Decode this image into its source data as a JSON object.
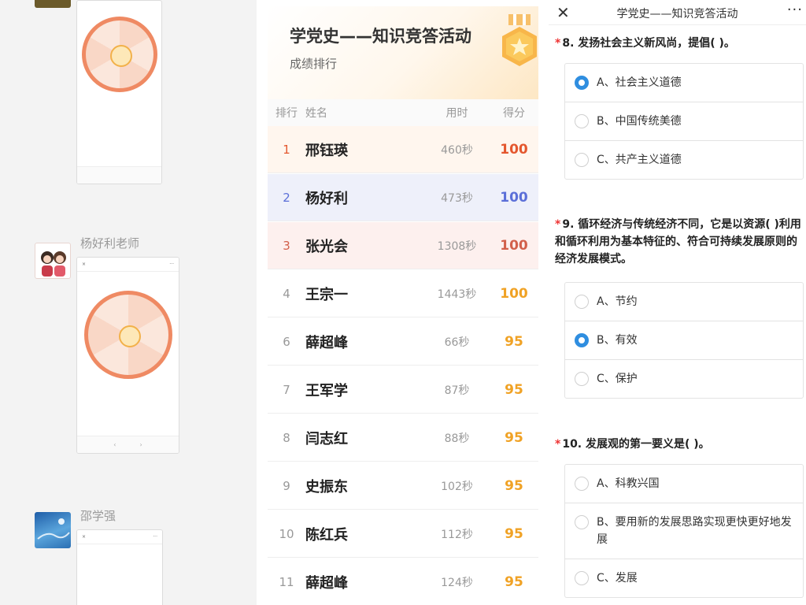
{
  "chat": {
    "messages": [
      {
        "sender": "",
        "thumb_text": ""
      },
      {
        "sender": "杨好利老师",
        "thumb_text": ""
      },
      {
        "sender": "邵学强",
        "thumb_text": ""
      }
    ]
  },
  "ranking": {
    "title": "学党史——知识竞答活动",
    "subtitle": "成绩排行",
    "columns": {
      "rank": "排行",
      "name": "姓名",
      "time": "用时",
      "score": "得分"
    },
    "rows": [
      {
        "rank": "1",
        "name": "邢钰瑛",
        "time": "460秒",
        "score": "100"
      },
      {
        "rank": "2",
        "name": "杨好利",
        "time": "473秒",
        "score": "100"
      },
      {
        "rank": "3",
        "name": "张光会",
        "time": "1308秒",
        "score": "100"
      },
      {
        "rank": "4",
        "name": "王宗一",
        "time": "1443秒",
        "score": "100"
      },
      {
        "rank": "6",
        "name": "薛超峰",
        "time": "66秒",
        "score": "95"
      },
      {
        "rank": "7",
        "name": "王军学",
        "time": "87秒",
        "score": "95"
      },
      {
        "rank": "8",
        "name": "闫志红",
        "time": "88秒",
        "score": "95"
      },
      {
        "rank": "9",
        "name": "史振东",
        "time": "102秒",
        "score": "95"
      },
      {
        "rank": "10",
        "name": "陈红兵",
        "time": "112秒",
        "score": "95"
      },
      {
        "rank": "11",
        "name": "薛超峰",
        "time": "124秒",
        "score": "95"
      }
    ],
    "colors": {
      "rank1": "#e4572e",
      "rank2": "#5b6fd8",
      "rank3": "#d2604b",
      "score_high": "#f0a225",
      "score_rank2": "#5b6fd8"
    }
  },
  "quiz": {
    "title": "学党史——知识竞答活动",
    "close_icon": "close-icon",
    "more_icon": "more-icon",
    "questions": [
      {
        "text": "8. 发扬社会主义新风尚，提倡(     )。",
        "options": [
          {
            "label": "A、社会主义道德",
            "selected": true
          },
          {
            "label": "B、中国传统美德",
            "selected": false
          },
          {
            "label": "C、共产主义道德",
            "selected": false
          }
        ]
      },
      {
        "text": "9. 循环经济与传统经济不同，它是以资源(     )利用和循环利用为基本特征的、符合可持续发展原则的经济发展模式。",
        "options": [
          {
            "label": "A、节约",
            "selected": false
          },
          {
            "label": "B、有效",
            "selected": true
          },
          {
            "label": "C、保护",
            "selected": false
          }
        ]
      },
      {
        "text": "10. 发展观的第一要义是(     )。",
        "options": [
          {
            "label": "A、科教兴国",
            "selected": false
          },
          {
            "label": "B、要用新的发展思路实现更快更好地发展",
            "selected": false
          },
          {
            "label": "C、发展",
            "selected": false
          }
        ]
      }
    ],
    "accent": "#2f8ee0"
  }
}
